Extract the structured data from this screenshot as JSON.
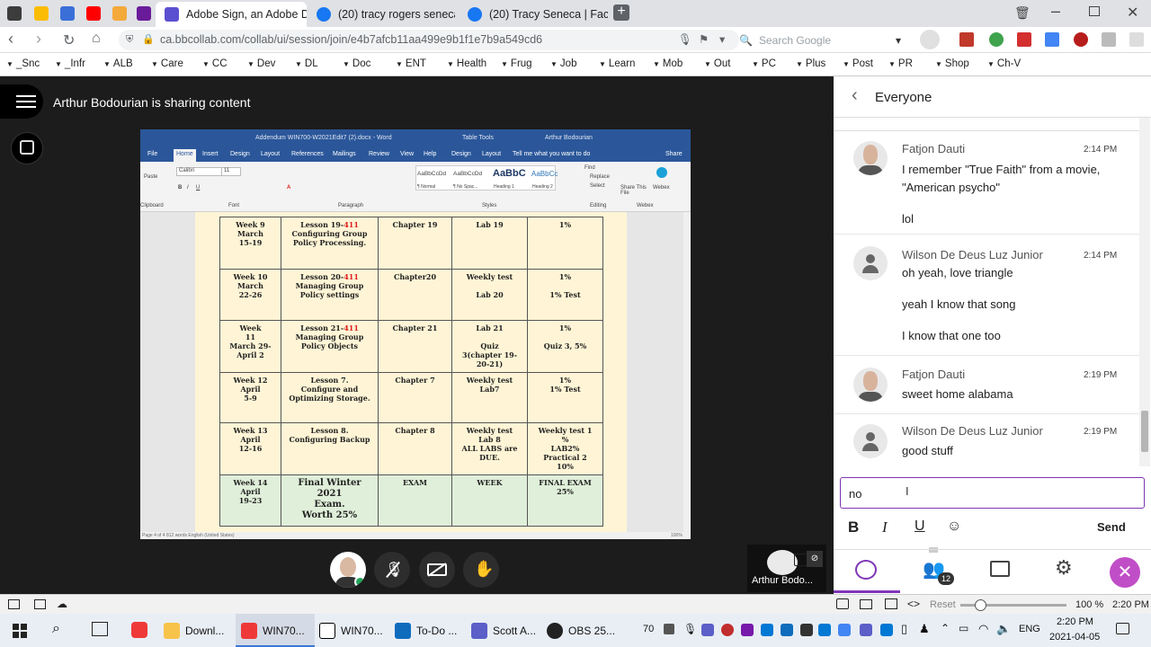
{
  "browser": {
    "tabs": [
      {
        "label": "Adobe Sign, an Adobe Doc",
        "icon": "adobe-sign-icon"
      },
      {
        "label": "(20) tracy rogers seneca - S",
        "icon": "facebook-icon"
      },
      {
        "label": "(20) Tracy Seneca | Faceboo",
        "icon": "facebook-icon"
      }
    ],
    "url": "ca.bbcollab.com/collab/ui/session/join/e4b7afcb11aa499e9b1f1e7b9a549cd6",
    "search_placeholder": "Search Google",
    "bookmarks": [
      "_Snc",
      "_Infr",
      "ALB",
      "Care",
      "CC",
      "Dev",
      "DL",
      "Doc",
      "ENT",
      "Health",
      "Frug",
      "Job",
      "Learn",
      "Mob",
      "Out",
      "PC",
      "Plus",
      "Post",
      "PR",
      "Shop",
      "Ch-V"
    ]
  },
  "session": {
    "sharing_text": "Arthur Bodourian is sharing content",
    "presenter_name": "Arthur Bodo..."
  },
  "word": {
    "title": "Addendum WIN700-W2021Edit7 (2).docx - Word",
    "table_tools": "Table Tools",
    "user": "Arthur Bodourian",
    "tabs": [
      "File",
      "Home",
      "Insert",
      "Design",
      "Layout",
      "References",
      "Mailings",
      "Review",
      "View",
      "Help",
      "Design",
      "Layout"
    ],
    "tell_me": "Tell me what you want to do",
    "share": "Share",
    "font": "Calibri",
    "font_size": "11",
    "styles": [
      "AaBbCcDd",
      "AaBbCcDd",
      "AaBbC",
      "AaBbCc"
    ],
    "style_names": [
      "¶ Normal",
      "¶ No Spac...",
      "Heading 1",
      "Heading 2"
    ],
    "groups": [
      "Clipboard",
      "Font",
      "Paragraph",
      "Styles",
      "Editing",
      "Webex"
    ],
    "editing": [
      "Find",
      "Replace",
      "Select"
    ],
    "webex": [
      "Share This File",
      "Webex"
    ],
    "paste": "Paste",
    "status": "Page 4 of 4    812 words    English (United States)",
    "zoom": "100%",
    "rows": [
      {
        "week": "Week 9\nMarch\n15-19",
        "lesson_pre": "Lesson 19-",
        "lesson_red": "411",
        "lesson_post": "\nConfiguring Group\nPolicy Processing.",
        "chapter": "Chapter 19",
        "lab": "Lab 19",
        "grade": "1%"
      },
      {
        "week": "Week 10\nMarch\n22-26",
        "lesson_pre": "Lesson 20-",
        "lesson_red": "411",
        "lesson_post": "\nManaging Group\nPolicy settings",
        "chapter": "Chapter20",
        "lab": "Weekly test\n\nLab 20",
        "grade": "1%\n\n1% Test"
      },
      {
        "week": "Week\n11\nMarch 29-\nApril 2",
        "lesson_pre": "Lesson 21-",
        "lesson_red": "411",
        "lesson_post": "\nManaging Group\nPolicy Objects",
        "chapter": "Chapter 21",
        "lab": "Lab 21\n\nQuiz\n3(chapter 19-\n20-21)",
        "grade": "1%\n\nQuiz 3, 5%"
      },
      {
        "week": "Week 12\nApril\n5-9",
        "lesson_pre": "Lesson 7.\nConfigure and\nOptimizing Storage.",
        "lesson_red": "",
        "lesson_post": "",
        "chapter": "Chapter 7",
        "lab": "Weekly test\nLab7",
        "grade": "1%\n1% Test"
      },
      {
        "week": "Week 13\nApril\n12-16",
        "lesson_pre": "Lesson 8.\nConfiguring Backup",
        "lesson_red": "",
        "lesson_post": "",
        "chapter": "Chapter 8",
        "lab": "Weekly test\nLab 8\nALL LABS are\nDUE.",
        "grade": "Weekly test 1\n%\nLAB2%\nPractical 2\n10%"
      },
      {
        "week": "Week 14\nApril\n19-23",
        "lesson_pre": "Final Winter\n2021\nExam.\nWorth 25%",
        "lesson_red": "",
        "lesson_post": "",
        "chapter": "EXAM",
        "lab": "WEEK",
        "grade": "FINAL EXAM\n25%"
      }
    ]
  },
  "chat": {
    "header": "Everyone",
    "messages": [
      {
        "name": "Fatjon Dauti",
        "time": "2:14 PM",
        "avatar": "photo",
        "texts": [
          "I remember \"True Faith\" from a movie, \"American psycho\"",
          "lol"
        ]
      },
      {
        "name": "Wilson De Deus Luz Junior",
        "time": "2:14 PM",
        "avatar": "generic",
        "texts": [
          "oh yeah, love triangle",
          "yeah I know that song",
          "I know that one too"
        ]
      },
      {
        "name": "Fatjon Dauti",
        "time": "2:19 PM",
        "avatar": "photo",
        "texts": [
          "sweet home alabama"
        ]
      },
      {
        "name": "Wilson De Deus Luz Junior",
        "time": "2:19 PM",
        "avatar": "generic",
        "texts": [
          "good stuff"
        ]
      }
    ],
    "input_value": "no",
    "send_label": "Send",
    "participants_count": "12"
  },
  "status_bar": {
    "reset": "Reset",
    "zoom": "100 %",
    "time": "2:20 PM"
  },
  "taskbar": {
    "items": [
      {
        "label": "Downl...",
        "icon": "folder-icon"
      },
      {
        "label": "WIN70...",
        "icon": "vivaldi-icon"
      },
      {
        "label": "WIN70...",
        "icon": "notion-icon"
      },
      {
        "label": "To-Do ...",
        "icon": "outlook-icon"
      },
      {
        "label": "Scott A...",
        "icon": "teams-icon"
      },
      {
        "label": "OBS 25...",
        "icon": "obs-icon"
      }
    ],
    "tray_num": "70",
    "lang": "ENG",
    "time": "2:20 PM",
    "date": "2021-04-05"
  }
}
